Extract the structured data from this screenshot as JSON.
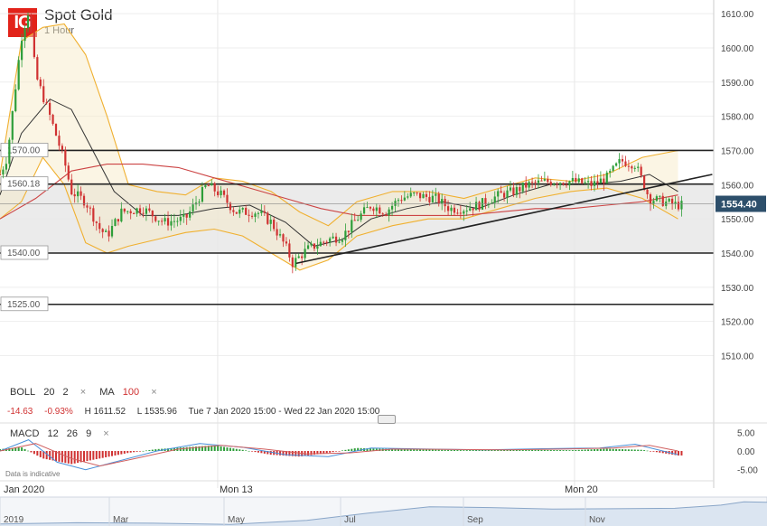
{
  "header": {
    "logo": "IG",
    "title": "Spot Gold",
    "timeframe": "1 Hour"
  },
  "indicators": {
    "boll": {
      "label": "BOLL",
      "p1": "20",
      "p2": "2",
      "close": "×"
    },
    "ma": {
      "label": "MA",
      "p1": "100",
      "close": "×"
    },
    "macd": {
      "label": "MACD",
      "p1": "12",
      "p2": "26",
      "p3": "9",
      "close": "×"
    }
  },
  "info": {
    "change": "-14.63",
    "change_pct": "-0.93%",
    "high": "H 1611.52",
    "low": "L 1535.96",
    "range": "Tue 7 Jan 2020 15:00 - Wed 22 Jan 2020 15:00"
  },
  "disclaimer": "Data is indicative",
  "colors": {
    "up": "#2e9e3a",
    "down": "#d03232",
    "boll": "#f0b030",
    "ma": "#cc4444",
    "mid": "#333333",
    "band": "#e6e6e6"
  },
  "chart_data": {
    "type": "candlestick",
    "ylim": [
      1503,
      1614
    ],
    "y_ticks": [
      "1510.00",
      "1520.00",
      "1530.00",
      "1540.00",
      "1550.00",
      "1560.00",
      "1570.00",
      "1580.00",
      "1590.00",
      "1600.00",
      "1610.00"
    ],
    "x_labels": [
      "Jan 2020",
      "Mon 13",
      "Mon 20"
    ],
    "current_price": "1554.40",
    "horizontal_levels": [
      {
        "value": 1570.0,
        "label": "1570.00"
      },
      {
        "value": 1560.18,
        "label": "1560.18"
      },
      {
        "value": 1540.0,
        "label": "1540.00"
      },
      {
        "value": 1525.0,
        "label": "1525.00"
      }
    ],
    "shaded_range": [
      1540,
      1560.18
    ],
    "trendline": {
      "x_start": 0.415,
      "y_start": 1537,
      "x_end": 0.998,
      "y_end": 1563
    },
    "close_anchors": [
      {
        "x": 0.0,
        "y": 1563
      },
      {
        "x": 0.01,
        "y": 1568
      },
      {
        "x": 0.03,
        "y": 1603
      },
      {
        "x": 0.04,
        "y": 1611
      },
      {
        "x": 0.05,
        "y": 1592
      },
      {
        "x": 0.07,
        "y": 1580
      },
      {
        "x": 0.09,
        "y": 1567
      },
      {
        "x": 0.1,
        "y": 1558
      },
      {
        "x": 0.12,
        "y": 1555
      },
      {
        "x": 0.14,
        "y": 1547
      },
      {
        "x": 0.15,
        "y": 1545
      },
      {
        "x": 0.17,
        "y": 1552
      },
      {
        "x": 0.2,
        "y": 1553
      },
      {
        "x": 0.23,
        "y": 1549
      },
      {
        "x": 0.26,
        "y": 1550
      },
      {
        "x": 0.29,
        "y": 1560
      },
      {
        "x": 0.31,
        "y": 1557
      },
      {
        "x": 0.33,
        "y": 1552
      },
      {
        "x": 0.36,
        "y": 1552
      },
      {
        "x": 0.38,
        "y": 1549
      },
      {
        "x": 0.4,
        "y": 1542
      },
      {
        "x": 0.41,
        "y": 1537
      },
      {
        "x": 0.43,
        "y": 1541
      },
      {
        "x": 0.46,
        "y": 1544
      },
      {
        "x": 0.48,
        "y": 1545
      },
      {
        "x": 0.5,
        "y": 1550
      },
      {
        "x": 0.52,
        "y": 1554
      },
      {
        "x": 0.54,
        "y": 1552
      },
      {
        "x": 0.56,
        "y": 1556
      },
      {
        "x": 0.58,
        "y": 1557
      },
      {
        "x": 0.61,
        "y": 1556
      },
      {
        "x": 0.63,
        "y": 1553
      },
      {
        "x": 0.65,
        "y": 1553
      },
      {
        "x": 0.67,
        "y": 1554
      },
      {
        "x": 0.7,
        "y": 1557
      },
      {
        "x": 0.72,
        "y": 1558
      },
      {
        "x": 0.74,
        "y": 1560
      },
      {
        "x": 0.77,
        "y": 1561
      },
      {
        "x": 0.8,
        "y": 1561
      },
      {
        "x": 0.83,
        "y": 1560
      },
      {
        "x": 0.85,
        "y": 1562
      },
      {
        "x": 0.87,
        "y": 1567
      },
      {
        "x": 0.89,
        "y": 1566
      },
      {
        "x": 0.91,
        "y": 1556
      },
      {
        "x": 0.93,
        "y": 1555
      },
      {
        "x": 0.95,
        "y": 1554
      }
    ],
    "boll_upper_anchors": [
      {
        "x": 0.0,
        "y": 1563
      },
      {
        "x": 0.03,
        "y": 1602
      },
      {
        "x": 0.06,
        "y": 1606
      },
      {
        "x": 0.09,
        "y": 1607
      },
      {
        "x": 0.12,
        "y": 1598
      },
      {
        "x": 0.15,
        "y": 1580
      },
      {
        "x": 0.18,
        "y": 1560
      },
      {
        "x": 0.22,
        "y": 1558
      },
      {
        "x": 0.26,
        "y": 1557
      },
      {
        "x": 0.3,
        "y": 1562
      },
      {
        "x": 0.34,
        "y": 1561
      },
      {
        "x": 0.38,
        "y": 1558
      },
      {
        "x": 0.42,
        "y": 1552
      },
      {
        "x": 0.46,
        "y": 1548
      },
      {
        "x": 0.5,
        "y": 1555
      },
      {
        "x": 0.55,
        "y": 1558
      },
      {
        "x": 0.6,
        "y": 1558
      },
      {
        "x": 0.65,
        "y": 1556
      },
      {
        "x": 0.7,
        "y": 1559
      },
      {
        "x": 0.75,
        "y": 1562
      },
      {
        "x": 0.8,
        "y": 1561
      },
      {
        "x": 0.85,
        "y": 1563
      },
      {
        "x": 0.9,
        "y": 1568
      },
      {
        "x": 0.95,
        "y": 1570
      }
    ],
    "boll_lower_anchors": [
      {
        "x": 0.0,
        "y": 1550
      },
      {
        "x": 0.03,
        "y": 1555
      },
      {
        "x": 0.06,
        "y": 1568
      },
      {
        "x": 0.09,
        "y": 1560
      },
      {
        "x": 0.12,
        "y": 1543
      },
      {
        "x": 0.15,
        "y": 1540
      },
      {
        "x": 0.18,
        "y": 1542
      },
      {
        "x": 0.22,
        "y": 1544
      },
      {
        "x": 0.26,
        "y": 1546
      },
      {
        "x": 0.3,
        "y": 1547
      },
      {
        "x": 0.34,
        "y": 1545
      },
      {
        "x": 0.38,
        "y": 1540
      },
      {
        "x": 0.42,
        "y": 1535
      },
      {
        "x": 0.46,
        "y": 1538
      },
      {
        "x": 0.5,
        "y": 1545
      },
      {
        "x": 0.55,
        "y": 1548
      },
      {
        "x": 0.6,
        "y": 1550
      },
      {
        "x": 0.65,
        "y": 1550
      },
      {
        "x": 0.7,
        "y": 1553
      },
      {
        "x": 0.75,
        "y": 1556
      },
      {
        "x": 0.8,
        "y": 1558
      },
      {
        "x": 0.85,
        "y": 1559
      },
      {
        "x": 0.9,
        "y": 1556
      },
      {
        "x": 0.95,
        "y": 1550
      }
    ],
    "boll_mid_anchors": [
      {
        "x": 0.0,
        "y": 1557
      },
      {
        "x": 0.03,
        "y": 1575
      },
      {
        "x": 0.07,
        "y": 1585
      },
      {
        "x": 0.1,
        "y": 1582
      },
      {
        "x": 0.13,
        "y": 1570
      },
      {
        "x": 0.16,
        "y": 1558
      },
      {
        "x": 0.2,
        "y": 1551
      },
      {
        "x": 0.25,
        "y": 1551
      },
      {
        "x": 0.3,
        "y": 1553
      },
      {
        "x": 0.35,
        "y": 1554
      },
      {
        "x": 0.4,
        "y": 1549
      },
      {
        "x": 0.44,
        "y": 1542
      },
      {
        "x": 0.48,
        "y": 1544
      },
      {
        "x": 0.52,
        "y": 1550
      },
      {
        "x": 0.57,
        "y": 1553
      },
      {
        "x": 0.62,
        "y": 1555
      },
      {
        "x": 0.67,
        "y": 1553
      },
      {
        "x": 0.72,
        "y": 1557
      },
      {
        "x": 0.77,
        "y": 1560
      },
      {
        "x": 0.82,
        "y": 1560
      },
      {
        "x": 0.87,
        "y": 1561
      },
      {
        "x": 0.91,
        "y": 1563
      },
      {
        "x": 0.95,
        "y": 1558
      }
    ],
    "ma_anchors": [
      {
        "x": 0.0,
        "y": 1550
      },
      {
        "x": 0.05,
        "y": 1556
      },
      {
        "x": 0.1,
        "y": 1564
      },
      {
        "x": 0.15,
        "y": 1566
      },
      {
        "x": 0.2,
        "y": 1566
      },
      {
        "x": 0.25,
        "y": 1565
      },
      {
        "x": 0.3,
        "y": 1562
      },
      {
        "x": 0.35,
        "y": 1559
      },
      {
        "x": 0.4,
        "y": 1556
      },
      {
        "x": 0.45,
        "y": 1553
      },
      {
        "x": 0.5,
        "y": 1551
      },
      {
        "x": 0.55,
        "y": 1551
      },
      {
        "x": 0.6,
        "y": 1551
      },
      {
        "x": 0.65,
        "y": 1551
      },
      {
        "x": 0.7,
        "y": 1552
      },
      {
        "x": 0.75,
        "y": 1553
      },
      {
        "x": 0.8,
        "y": 1553
      },
      {
        "x": 0.85,
        "y": 1554
      },
      {
        "x": 0.9,
        "y": 1555
      },
      {
        "x": 0.95,
        "y": 1557
      }
    ],
    "macd": {
      "ylim": [
        -7,
        7
      ],
      "y_ticks": [
        "5.00",
        "0.00",
        "-5.00"
      ],
      "hist_anchors": [
        {
          "x": 0.0,
          "y": 0.5
        },
        {
          "x": 0.03,
          "y": 1
        },
        {
          "x": 0.06,
          "y": -2
        },
        {
          "x": 0.1,
          "y": -3.5
        },
        {
          "x": 0.14,
          "y": -2
        },
        {
          "x": 0.18,
          "y": -0.5
        },
        {
          "x": 0.22,
          "y": 0.5
        },
        {
          "x": 0.26,
          "y": 1
        },
        {
          "x": 0.3,
          "y": 1.5
        },
        {
          "x": 0.34,
          "y": 0.3
        },
        {
          "x": 0.38,
          "y": -1
        },
        {
          "x": 0.42,
          "y": -1.5
        },
        {
          "x": 0.46,
          "y": -0.5
        },
        {
          "x": 0.5,
          "y": 0.8
        },
        {
          "x": 0.55,
          "y": 0.5
        },
        {
          "x": 0.6,
          "y": 0.4
        },
        {
          "x": 0.65,
          "y": 0.2
        },
        {
          "x": 0.7,
          "y": 0.4
        },
        {
          "x": 0.75,
          "y": 0.3
        },
        {
          "x": 0.8,
          "y": 0.2
        },
        {
          "x": 0.85,
          "y": 0.6
        },
        {
          "x": 0.9,
          "y": 0.3
        },
        {
          "x": 0.95,
          "y": -1.2
        }
      ],
      "macd_line_anchors": [
        {
          "x": 0.0,
          "y": 0
        },
        {
          "x": 0.04,
          "y": 3
        },
        {
          "x": 0.08,
          "y": -3
        },
        {
          "x": 0.12,
          "y": -5
        },
        {
          "x": 0.16,
          "y": -3
        },
        {
          "x": 0.22,
          "y": 0
        },
        {
          "x": 0.28,
          "y": 2
        },
        {
          "x": 0.34,
          "y": 1
        },
        {
          "x": 0.4,
          "y": -1
        },
        {
          "x": 0.46,
          "y": -1.5
        },
        {
          "x": 0.52,
          "y": 0.8
        },
        {
          "x": 0.6,
          "y": 0.5
        },
        {
          "x": 0.68,
          "y": 0.3
        },
        {
          "x": 0.76,
          "y": 0.6
        },
        {
          "x": 0.84,
          "y": 0.8
        },
        {
          "x": 0.89,
          "y": 1.8
        },
        {
          "x": 0.95,
          "y": -1
        }
      ],
      "signal_line_anchors": [
        {
          "x": 0.0,
          "y": 0
        },
        {
          "x": 0.05,
          "y": 2
        },
        {
          "x": 0.1,
          "y": -2
        },
        {
          "x": 0.14,
          "y": -4
        },
        {
          "x": 0.19,
          "y": -2
        },
        {
          "x": 0.25,
          "y": 0.5
        },
        {
          "x": 0.31,
          "y": 1.5
        },
        {
          "x": 0.37,
          "y": 0.5
        },
        {
          "x": 0.43,
          "y": -0.8
        },
        {
          "x": 0.49,
          "y": -0.5
        },
        {
          "x": 0.55,
          "y": 0.5
        },
        {
          "x": 0.63,
          "y": 0.4
        },
        {
          "x": 0.71,
          "y": 0.3
        },
        {
          "x": 0.79,
          "y": 0.5
        },
        {
          "x": 0.86,
          "y": 0.8
        },
        {
          "x": 0.91,
          "y": 1.5
        },
        {
          "x": 0.95,
          "y": 0
        }
      ]
    },
    "navigator": {
      "labels": [
        "2019",
        "Mar",
        "May",
        "Jul",
        "Sep",
        "Nov"
      ],
      "window_start_fraction": 0.958,
      "ylim": [
        1260,
        1620
      ],
      "line_anchors": [
        {
          "x": 0.0,
          "y": 1285
        },
        {
          "x": 0.1,
          "y": 1300
        },
        {
          "x": 0.2,
          "y": 1295
        },
        {
          "x": 0.3,
          "y": 1280
        },
        {
          "x": 0.4,
          "y": 1330
        },
        {
          "x": 0.48,
          "y": 1420
        },
        {
          "x": 0.56,
          "y": 1500
        },
        {
          "x": 0.64,
          "y": 1490
        },
        {
          "x": 0.72,
          "y": 1470
        },
        {
          "x": 0.8,
          "y": 1475
        },
        {
          "x": 0.88,
          "y": 1480
        },
        {
          "x": 0.94,
          "y": 1520
        },
        {
          "x": 0.97,
          "y": 1560
        },
        {
          "x": 1.0,
          "y": 1555
        }
      ]
    }
  }
}
